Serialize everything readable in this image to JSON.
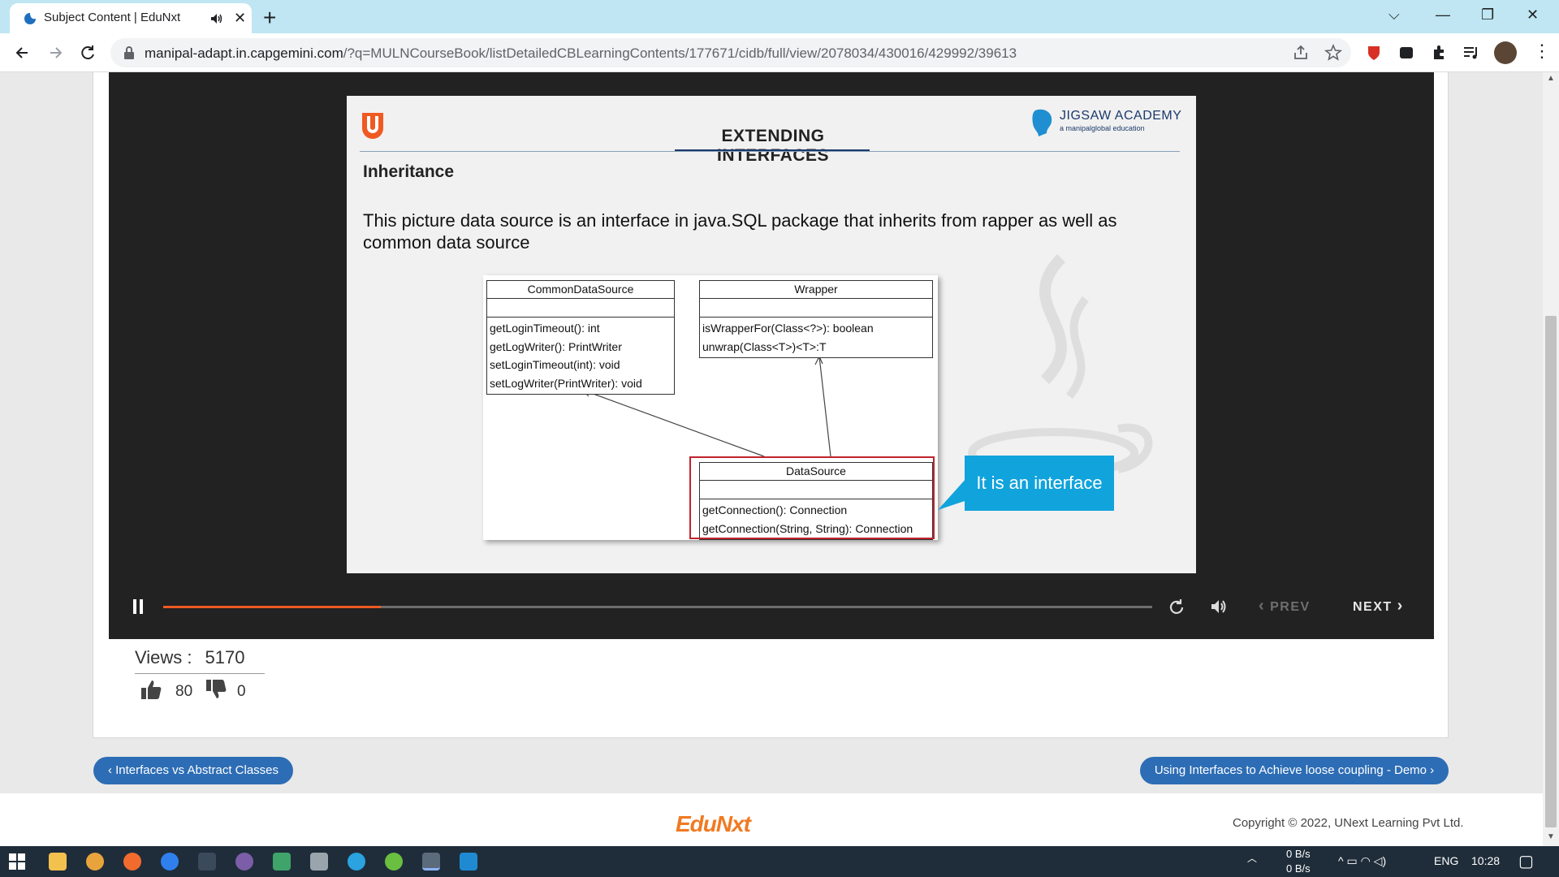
{
  "browser": {
    "tab_title": "Subject Content | EduNxt",
    "url_host": "manipal-adapt.in.capgemini.com",
    "url_path": "/?q=MULNCourseBook/listDetailedCBLearningContents/177671/cidb/full/view/2078034/430016/429992/39613"
  },
  "slide": {
    "title": "EXTENDING INTERFACES",
    "brand_name": "JIGSAW ACADEMY",
    "brand_sub": "a manipalglobal education",
    "subtitle": "Inheritance",
    "body": "This picture data source is an interface in java.SQL package that inherits from rapper as well as common data source",
    "callout": "It is an interface",
    "uml": {
      "common": {
        "name": "CommonDataSource",
        "ops": [
          "getLoginTimeout(): int",
          "getLogWriter(): PrintWriter",
          "setLoginTimeout(int): void",
          "setLogWriter(PrintWriter): void"
        ]
      },
      "wrapper": {
        "name": "Wrapper",
        "ops": [
          "isWrapperFor(Class<?>): boolean",
          "unwrap(Class<T>)<T>:T"
        ]
      },
      "datasource": {
        "name": "DataSource",
        "ops": [
          "getConnection(): Connection",
          "getConnection(String, String): Connection"
        ]
      }
    }
  },
  "player": {
    "progress_fraction": 0.22,
    "prev_label": "PREV",
    "next_label": "NEXT"
  },
  "stats": {
    "views_label": "Views :",
    "views_count": "5170",
    "likes": "80",
    "dislikes": "0"
  },
  "navigation": {
    "prev_lesson": "‹ Interfaces vs Abstract Classes",
    "next_lesson": "Using Interfaces to Achieve loose coupling - Demo ›"
  },
  "footer": {
    "logo": "EduNxt",
    "copyright": "Copyright © 2022, UNext Learning Pvt Ltd."
  },
  "taskbar": {
    "net_up": "0 B/s",
    "net_down": "0 B/s",
    "lang": "ENG",
    "time": "10:28"
  },
  "colors": {
    "accent_orange": "#f05a22",
    "nav_blue": "#2d6db5",
    "callout_blue": "#11a3dc",
    "highlight_red": "#c0232c"
  }
}
